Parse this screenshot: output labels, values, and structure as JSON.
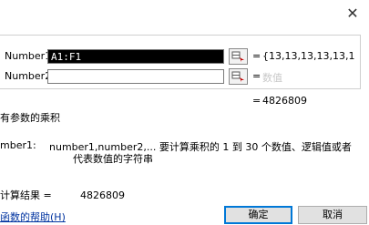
{
  "dialog": {
    "close_glyph": "✕"
  },
  "args": [
    {
      "label": "Number1",
      "value": "A1:F1",
      "eq": "=",
      "result": "{13,13,13,13,13,1",
      "filled": true
    },
    {
      "label": "Number2",
      "value": "",
      "eq": "=",
      "result": "数值",
      "filled": false
    }
  ],
  "formula_result_line": {
    "eq": "=",
    "value": "4826809"
  },
  "function_description": "有参数的乘积",
  "argument_help": {
    "label": "mber1:",
    "text_line1": "number1,number2,... 要计算乘积的 1 到 30 个数值、逻辑值或者",
    "text_line2": "代表数值的字符串"
  },
  "calc_result": {
    "label": "计算结果 =",
    "value": "4826809"
  },
  "help_link": "函数的帮助(H)",
  "buttons": {
    "ok": "确定",
    "cancel": "取消"
  },
  "colors": {
    "accent": "#0078d7",
    "link": "#0033a0",
    "placeholder": "#c8c8c8"
  }
}
